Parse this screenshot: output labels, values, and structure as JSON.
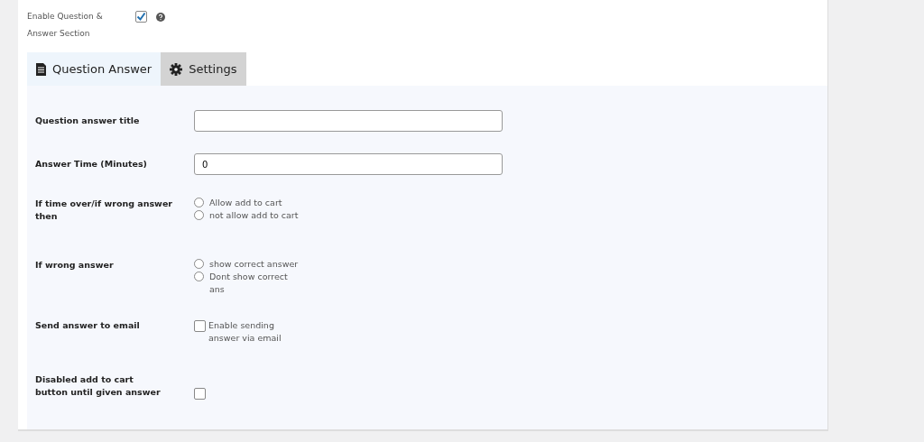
{
  "enable_section": {
    "label": "Enable Question & Answer Section",
    "checked": true
  },
  "tabs": [
    {
      "label": "Question Answer",
      "selected": true
    },
    {
      "label": "Settings",
      "selected": false
    }
  ],
  "fields": [
    {
      "kind": "text",
      "label": "Question answer title"
    },
    {
      "kind": "text",
      "label": "Answer Time (Minutes)",
      "value": "0"
    },
    {
      "kind": "radio",
      "label": "If time over/if wrong answer then",
      "options": [
        {
          "label": "Allow add to cart",
          "selected": false
        },
        {
          "label": "not allow add to cart",
          "selected": false
        }
      ]
    },
    {
      "kind": "radio",
      "label": "If wrong answer",
      "options": [
        {
          "label": "show correct answer",
          "selected": false
        },
        {
          "label": "Dont show correct ans",
          "selected": false
        }
      ]
    },
    {
      "kind": "checkbox",
      "label": "Send answer to email",
      "option": "Enable sending answer via email",
      "checked": false
    },
    {
      "kind": "checkbox",
      "label": "Disabled add to cart button until given answer",
      "checked": false
    }
  ]
}
